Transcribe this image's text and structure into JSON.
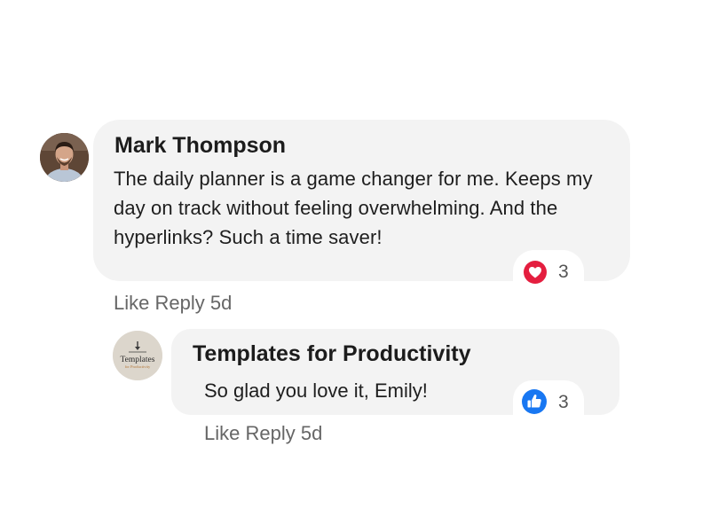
{
  "comment": {
    "author": "Mark Thompson",
    "text": "The daily planner is a game changer for me. Keeps my day on track without feeling overwhelming. And the hyperlinks? Such a time saver!",
    "reaction": {
      "icon": "heart-icon",
      "color": "#e41e3f",
      "count": "3"
    },
    "actions": {
      "like": "Like",
      "reply": "Reply",
      "time": "5d"
    }
  },
  "reply": {
    "author": "Templates for Productivity",
    "avatar_text": {
      "main": "Templates",
      "sub": "for Productivity"
    },
    "text": "So glad you love it, Emily!",
    "reaction": {
      "icon": "thumbs-up-icon",
      "color": "#1877f2",
      "count": "3"
    },
    "actions": {
      "like": "Like",
      "reply": "Reply",
      "time": "5d"
    }
  },
  "colors": {
    "bubble": "#f3f3f3",
    "text": "#1e1e1e",
    "muted": "#666666"
  }
}
